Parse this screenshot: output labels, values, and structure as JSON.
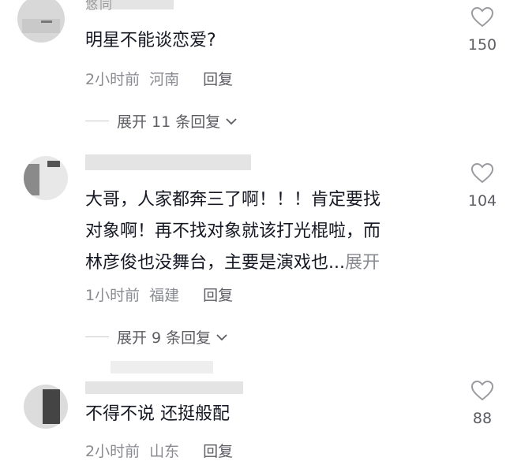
{
  "comments": [
    {
      "name_fragment": "悠同",
      "text": "明星不能谈恋爱?",
      "time": "2小时前",
      "location": "河南",
      "reply_label": "回复",
      "likes": "150",
      "expand_label": "展开 11 条回复"
    },
    {
      "line1": "大哥，人家都奔三了啊！！！肯定要找",
      "line2": "对象啊！再不找对象就该打光棍啦，而",
      "line3": "林彦俊也没舞台，主要是演戏也...",
      "more_label": "展开",
      "time": "1小时前",
      "location": "福建",
      "reply_label": "回复",
      "likes": "104",
      "expand_label": "展开 9 条回复"
    },
    {
      "text": "不得不说 还挺般配",
      "time": "2小时前",
      "location": "山东",
      "reply_label": "回复",
      "likes": "88"
    }
  ],
  "colors": {
    "text": "#161823",
    "meta": "#8a8b91",
    "icon": "#9a9ba0"
  },
  "icons": {
    "like": "heart-outline-icon",
    "chevron": "chevron-down-icon"
  }
}
